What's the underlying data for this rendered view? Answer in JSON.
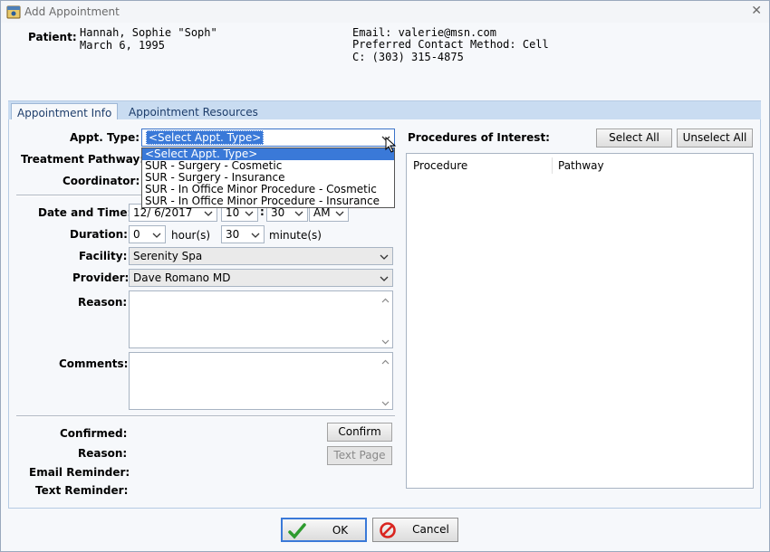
{
  "window": {
    "title": "Add Appointment",
    "close_glyph": "✕"
  },
  "patient": {
    "label": "Patient:",
    "name": "Hannah, Sophie \"Soph\"",
    "dob": "March 6, 1995",
    "email": "Email: valerie@msn.com",
    "preferred_contact": "Preferred Contact Method: Cell",
    "phone": "C: (303) 315-4875"
  },
  "tabs": [
    {
      "label": "Appointment Info",
      "active": true
    },
    {
      "label": "Appointment Resources",
      "active": false
    }
  ],
  "form": {
    "appt_type_label": "Appt. Type:",
    "appt_type_value": "<Select Appt. Type>",
    "appt_type_options": [
      "<Select Appt. Type>",
      "SUR - Surgery - Cosmetic",
      "SUR - Surgery - Insurance",
      "SUR - In Office Minor Procedure - Cosmetic",
      "SUR - In Office Minor Procedure - Insurance"
    ],
    "treatment_pathway_label": "Treatment Pathway:",
    "coordinator_label": "Coordinator:",
    "date_time_label": "Date and Time:",
    "date_value": "12/ 6/2017",
    "hour_value": "10",
    "time_colon": ":",
    "minute_value": "30",
    "ampm_value": "AM",
    "duration_label": "Duration:",
    "duration_hours": "0",
    "hours_unit": "hour(s)",
    "duration_minutes": "30",
    "minutes_unit": "minute(s)",
    "facility_label": "Facility:",
    "facility_value": "Serenity Spa",
    "provider_label": "Provider:",
    "provider_value": "Dave Romano MD",
    "reason_label": "Reason:",
    "comments_label": "Comments:",
    "confirmed_label": "Confirmed:",
    "reason2_label": "Reason:",
    "email_reminder_label": "Email Reminder:",
    "text_reminder_label": "Text Reminder:",
    "confirm_button": "Confirm",
    "text_page_button": "Text Page"
  },
  "procedures": {
    "title": "Procedures of Interest:",
    "select_all": "Select All",
    "unselect_all": "Unselect All",
    "columns": [
      "Procedure",
      "Pathway"
    ]
  },
  "footer": {
    "ok": "OK",
    "cancel": "Cancel"
  },
  "colors": {
    "accent": "#3a79d8",
    "tab_strip": "#c9dcf1",
    "ok_check": "#2e9b2e",
    "cancel_red": "#d9241f"
  }
}
